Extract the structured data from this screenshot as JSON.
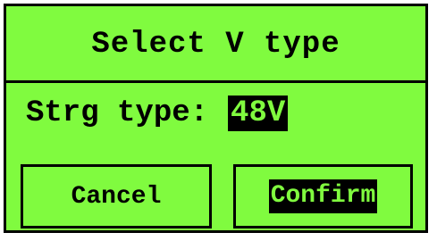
{
  "dialog": {
    "title": "Select V type",
    "field_label": "Strg type:",
    "field_value": "48V",
    "cancel_label": "Cancel",
    "confirm_label": "Confirm"
  },
  "colors": {
    "background": "#80fb3f",
    "foreground": "#000000",
    "highlight_bg": "#000000",
    "highlight_fg": "#80fb3f"
  }
}
